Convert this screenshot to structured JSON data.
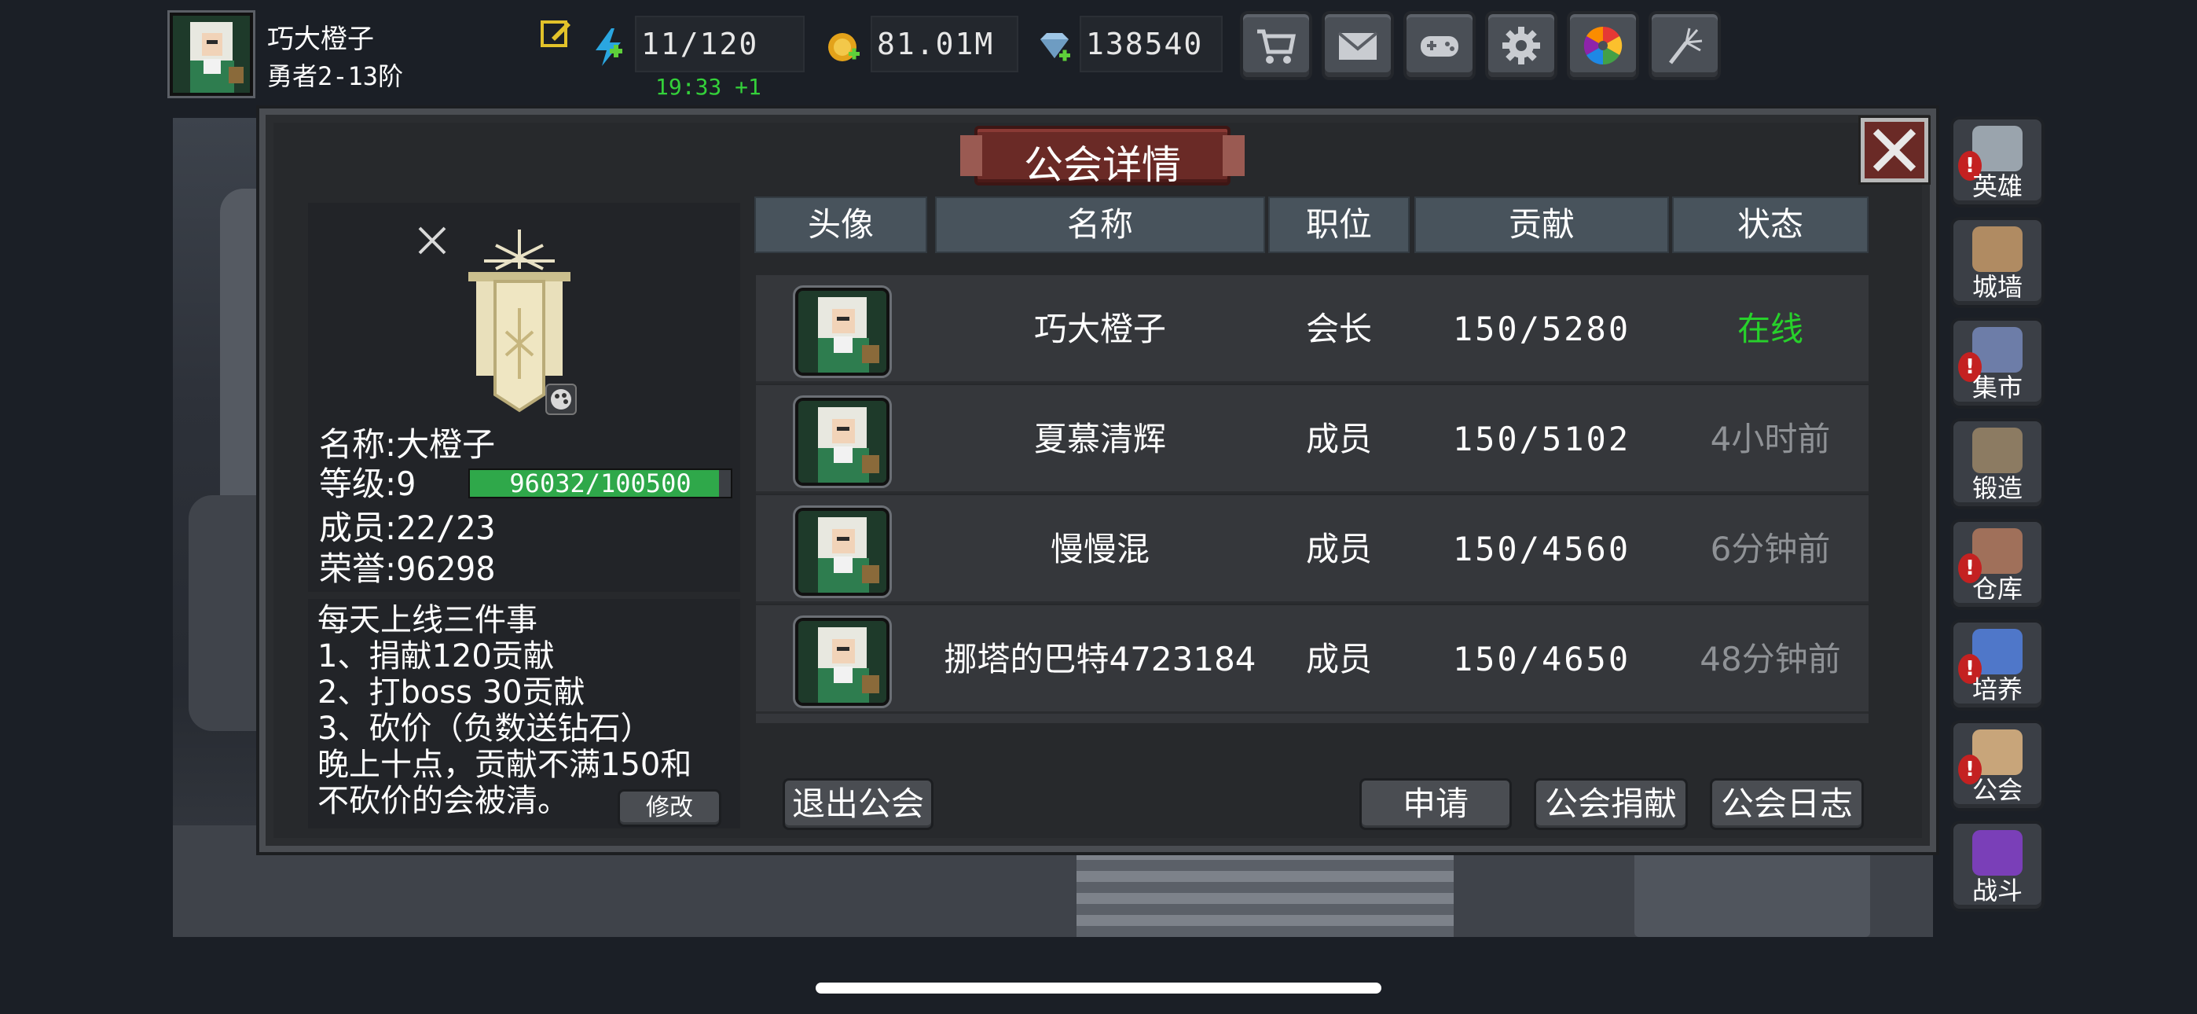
{
  "player": {
    "name": "巧大橙子",
    "rank": "勇者2-13阶"
  },
  "resources": {
    "energy": "11/120",
    "energy_timer": "19:33 +1",
    "gold": "81.01M",
    "gems": "138540"
  },
  "top_buttons": [
    "cart-icon",
    "mail-icon",
    "gamepad-icon",
    "gear-icon",
    "color-wheel-icon",
    "fireworks-icon"
  ],
  "dialog": {
    "title": "公会详情"
  },
  "guild": {
    "name_label": "名称:",
    "name": "大橙子",
    "level_label": "等级:",
    "level": "9",
    "xp_text": "96032/100500",
    "xp_progress": 0.955,
    "members_label": "成员:",
    "members": "22/23",
    "honor_label": "荣誉:",
    "honor": "96298",
    "notice": [
      "每天上线三件事",
      "1、捐献120贡献",
      "2、打boss 30贡献",
      "3、砍价（负数送钻石）",
      "晚上十点，贡献不满150和",
      "不砍价的会被清。"
    ],
    "edit_label": "修改"
  },
  "table": {
    "headers": [
      "头像",
      "名称",
      "职位",
      "贡献",
      "状态"
    ],
    "rows": [
      {
        "name": "巧大橙子",
        "role": "会长",
        "contribution": "150/5280",
        "status": "在线",
        "online": true
      },
      {
        "name": "夏慕清辉",
        "role": "成员",
        "contribution": "150/5102",
        "status": "4小时前",
        "online": false
      },
      {
        "name": "慢慢混",
        "role": "成员",
        "contribution": "150/4560",
        "status": "6分钟前",
        "online": false
      },
      {
        "name": "挪塔的巴特4723184",
        "role": "成员",
        "contribution": "150/4650",
        "status": "48分钟前",
        "online": false
      }
    ]
  },
  "buttons": {
    "leave": "退出公会",
    "apply": "申请",
    "donate": "公会捐献",
    "log": "公会日志"
  },
  "sidebar": [
    {
      "label": "英雄",
      "icon": "helmet-icon",
      "alert": true
    },
    {
      "label": "城墙",
      "icon": "castle-wall-icon",
      "alert": false
    },
    {
      "label": "集市",
      "icon": "market-icon",
      "alert": true
    },
    {
      "label": "锻造",
      "icon": "anvil-icon",
      "alert": false
    },
    {
      "label": "仓库",
      "icon": "warehouse-icon",
      "alert": true
    },
    {
      "label": "培养",
      "icon": "trophy-icon",
      "alert": true
    },
    {
      "label": "公会",
      "icon": "guild-icon",
      "alert": true
    },
    {
      "label": "战斗",
      "icon": "portal-icon",
      "alert": false
    }
  ],
  "colors": {
    "online": "#27d12b",
    "offline": "#8f9296",
    "xp_fill": "#2fa84a",
    "title_banner": "#6a2a26"
  }
}
